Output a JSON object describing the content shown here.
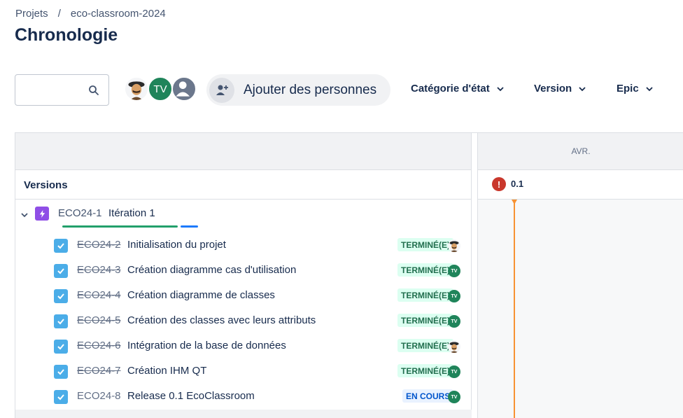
{
  "breadcrumb": {
    "projects": "Projets",
    "separator": "/",
    "project": "eco-classroom-2024"
  },
  "page": {
    "title": "Chronologie"
  },
  "toolbar": {
    "search_placeholder": "",
    "avatars": [
      {
        "type": "photo",
        "icon": "person-avatar"
      },
      {
        "type": "initials",
        "initials": "TV",
        "color": "#1f845a"
      },
      {
        "type": "generic",
        "icon": "user-placeholder-icon"
      }
    ],
    "add_people_label": "Ajouter des personnes",
    "filters": [
      {
        "label": "Catégorie d'état"
      },
      {
        "label": "Version"
      },
      {
        "label": "Epic"
      }
    ]
  },
  "timeline": {
    "month": "AVR.",
    "versions_label": "Versions",
    "version": {
      "marker": "!",
      "name": "0.1"
    },
    "today_color": "#f79233"
  },
  "epic": {
    "key": "ECO24-1",
    "title": "Itération 1",
    "progress": {
      "done_fraction": 0.86,
      "in_progress_fraction": 0.14
    },
    "color": "#8f4ee6"
  },
  "issues": [
    {
      "key": "ECO24-2",
      "title": "Initialisation du projet",
      "status": "TERMINÉ(E)",
      "status_type": "done",
      "assignee": "photo"
    },
    {
      "key": "ECO24-3",
      "title": "Création diagramme cas d'utilisation",
      "status": "TERMINÉ(E)",
      "status_type": "done",
      "assignee": "TV"
    },
    {
      "key": "ECO24-4",
      "title": "Création diagramme de classes",
      "status": "TERMINÉ(E)",
      "status_type": "done",
      "assignee": "TV"
    },
    {
      "key": "ECO24-5",
      "title": "Création des classes avec leurs attributs",
      "status": "TERMINÉ(E)",
      "status_type": "done",
      "assignee": "TV"
    },
    {
      "key": "ECO24-6",
      "title": "Intégration de la base de données",
      "status": "TERMINÉ(E)",
      "status_type": "done",
      "assignee": "photo"
    },
    {
      "key": "ECO24-7",
      "title": "Création IHM QT",
      "status": "TERMINÉ(E)",
      "status_type": "done",
      "assignee": "TV"
    },
    {
      "key": "ECO24-8",
      "title": "Release 0.1 EcoClassroom",
      "status": "EN COURS",
      "status_type": "inprogress",
      "assignee": "TV"
    }
  ]
}
